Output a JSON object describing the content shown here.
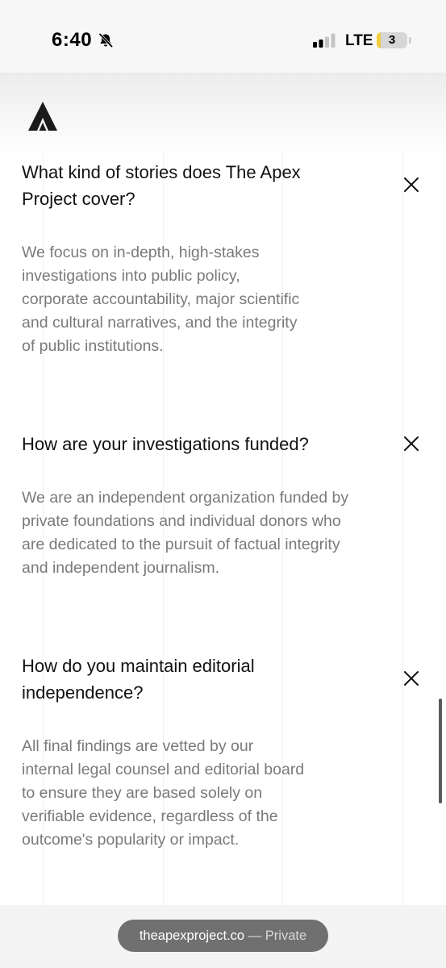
{
  "status_bar": {
    "time": "6:40",
    "network": "LTE",
    "battery_level": "3",
    "battery_color": "#f2cc3a",
    "silent_icon": "bell-slash-icon",
    "signal_icon": "signal-bars-icon"
  },
  "header": {
    "logo_icon": "apex-logo-icon"
  },
  "faq": {
    "close_icon": "close-icon",
    "items": [
      {
        "question": "What kind of stories does The Apex Project cover?",
        "answer": "We focus on in-depth, high-stakes investigations into public policy, corporate accountability, major scientific and cultural narratives, and the integrity of public institutions."
      },
      {
        "question": "How are your investigations funded?",
        "answer": "We are an independent organization funded by private foundations and individual donors who are dedicated to the pursuit of factual integrity and independent journalism."
      },
      {
        "question": "How do you maintain editorial independence?",
        "answer": "All final findings are vetted by our internal legal counsel and editorial board to ensure they are based solely on verifiable evidence, regardless of the outcome's popularity or impact."
      }
    ]
  },
  "browser_bar": {
    "domain": "theapexproject.co",
    "separator": " — ",
    "mode": "Private"
  }
}
